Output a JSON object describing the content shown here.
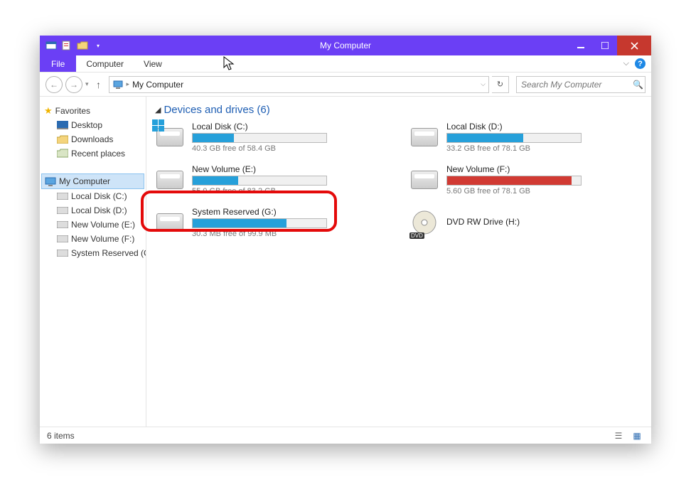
{
  "window": {
    "title": "My Computer"
  },
  "ribbon": {
    "file": "File",
    "tabs": [
      "Computer",
      "View"
    ]
  },
  "nav": {
    "breadcrumb": "My Computer",
    "search_placeholder": "Search My Computer"
  },
  "tree": {
    "favorites_label": "Favorites",
    "favorites": [
      {
        "label": "Desktop",
        "icon": "desktop-icon"
      },
      {
        "label": "Downloads",
        "icon": "folder-icon"
      },
      {
        "label": "Recent places",
        "icon": "recent-icon"
      }
    ],
    "computer_label": "My Computer",
    "computer_children": [
      {
        "label": "Local Disk (C:)"
      },
      {
        "label": "Local Disk (D:)"
      },
      {
        "label": "New Volume (E:)"
      },
      {
        "label": "New Volume (F:)"
      },
      {
        "label": "System Reserved (G:)"
      }
    ]
  },
  "group": {
    "title": "Devices and drives (6)"
  },
  "drives": [
    {
      "name": "Local Disk (C:)",
      "free_text": "40.3 GB free of 58.4 GB",
      "fill_pct": 31,
      "color": "blue",
      "type": "hdd",
      "win_logo": true
    },
    {
      "name": "Local Disk (D:)",
      "free_text": "33.2 GB free of 78.1 GB",
      "fill_pct": 57,
      "color": "blue",
      "type": "hdd"
    },
    {
      "name": "New Volume (E:)",
      "free_text": "55.0 GB free of 83.2 GB",
      "fill_pct": 34,
      "color": "blue",
      "type": "hdd"
    },
    {
      "name": "New Volume (F:)",
      "free_text": "5.60 GB free of 78.1 GB",
      "fill_pct": 93,
      "color": "red",
      "type": "hdd"
    },
    {
      "name": "System Reserved (G:)",
      "free_text": "30.3 MB free of 99.9 MB",
      "fill_pct": 70,
      "color": "blue",
      "type": "hdd"
    },
    {
      "name": "DVD RW Drive (H:)",
      "free_text": "",
      "fill_pct": 0,
      "color": "none",
      "type": "dvd"
    }
  ],
  "status": {
    "count_text": "6 items"
  }
}
